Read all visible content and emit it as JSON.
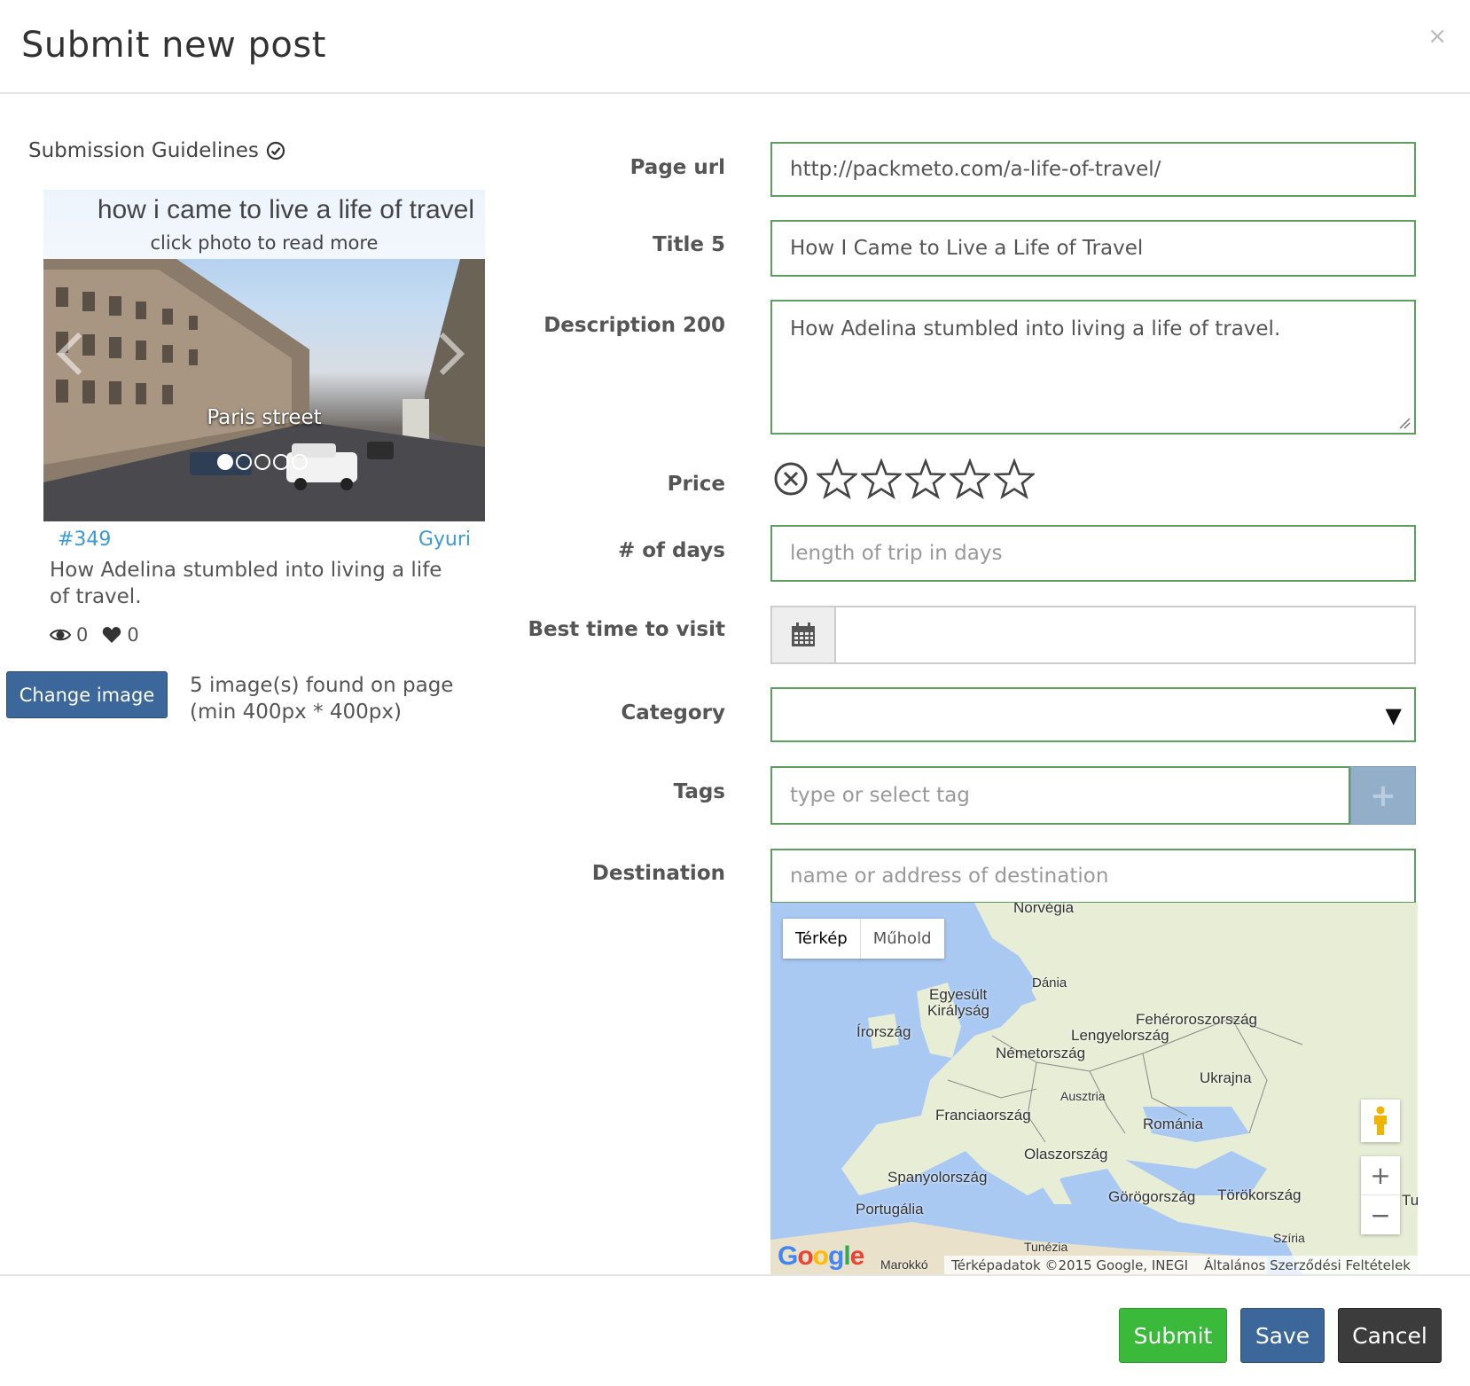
{
  "modal": {
    "title": "Submit new post",
    "close": "×"
  },
  "left": {
    "guidelines": "Submission Guidelines",
    "card": {
      "banner_title": "how i came to live a life of travel",
      "banner_sub": "click photo to read more",
      "caption": "Paris street",
      "dots": 5,
      "id": "#349",
      "author": "Gyuri",
      "description": "How Adelina stumbled into living a life of travel.",
      "views": "0",
      "likes": "0"
    },
    "change_image": "Change image",
    "found_line1": "5 image(s) found on page",
    "found_line2": "(min 400px * 400px)"
  },
  "form": {
    "page_url": {
      "label": "Page url",
      "value": "http://packmeto.com/a-life-of-travel/"
    },
    "title": {
      "label": "Title 5",
      "value": "How I Came to Live a Life of Travel"
    },
    "description": {
      "label": "Description 200",
      "value": "How Adelina stumbled into living a life of travel."
    },
    "price": {
      "label": "Price",
      "rating": 0,
      "max": 5
    },
    "days": {
      "label": "# of days",
      "placeholder": "length of trip in days"
    },
    "best_time": {
      "label": "Best time to visit",
      "value": ""
    },
    "category": {
      "label": "Category",
      "value": "",
      "arrow": "▼"
    },
    "tags": {
      "label": "Tags",
      "placeholder": "type or select tag",
      "add": "+"
    },
    "destination": {
      "label": "Destination",
      "placeholder": "name or address of destination"
    }
  },
  "map": {
    "type_map": "Térkép",
    "type_satellite": "Műhold",
    "labels": {
      "norvegia": "Norvégia",
      "dania": "Dánia",
      "egyesult1": "Egyesült",
      "egyesult2": "Királyság",
      "irorszag": "Írország",
      "feher": "Fehéroroszország",
      "lengyel": "Lengyelország",
      "nemet": "Németország",
      "ukrajna": "Ukrajna",
      "ausztria": "Ausztria",
      "francia": "Franciaország",
      "romania": "Románia",
      "olasz": "Olaszország",
      "spanyol": "Spanyolország",
      "gorog": "Görögország",
      "torok": "Törökország",
      "portugalia": "Portugália",
      "tunezia": "Tunézia",
      "szíria": "Szíria",
      "marokko": "Marokkó",
      "tu": "Tu"
    },
    "zoom_in": "+",
    "zoom_out": "−",
    "logo": "Google",
    "attribution": "Térképadatok ©2015 Google, INEGI",
    "terms": "Általános Szerződési Feltételek"
  },
  "footer": {
    "submit": "Submit",
    "save": "Save",
    "cancel": "Cancel"
  },
  "colors": {
    "field_border": "#5da05d",
    "primary": "#3b679a",
    "success": "#3ab93a",
    "dark": "#3c3c3c",
    "link": "#3a9ad9"
  }
}
